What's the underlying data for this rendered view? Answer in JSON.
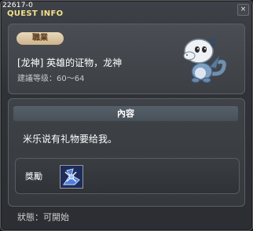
{
  "window": {
    "quest_id": "22617-0",
    "title": "QUEST INFO",
    "close_label": "×"
  },
  "quest": {
    "job_badge": "職業",
    "name": "[龙神] 英雄的证物，龙神",
    "level": "建議等级：60～64"
  },
  "content": {
    "header": "內容",
    "text": "米乐说有礼物要给我。",
    "reward_label": "獎勵"
  },
  "status": "狀態：可開始",
  "colors": {
    "title": "#f3e08a",
    "badge": "#e0cca8",
    "reward_icon": "#4a7bd6"
  },
  "icons": {
    "dragon_image": "baby-dragon-icon",
    "reward_item": "reward-item-icon"
  }
}
